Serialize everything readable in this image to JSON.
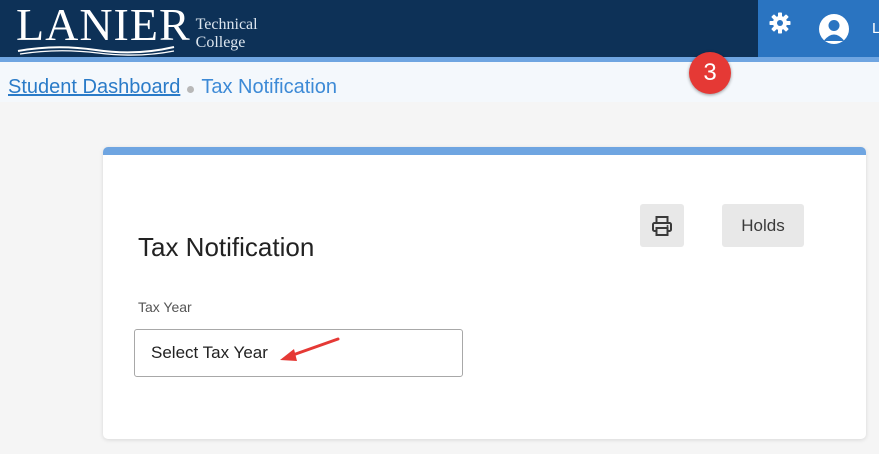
{
  "header": {
    "logo_main": "LANIER",
    "logo_sub_line1": "Technical",
    "logo_sub_line2": "College",
    "settings_icon": "gear-icon",
    "user_icon": "user-avatar-icon",
    "user_initial": "L"
  },
  "breadcrumb": {
    "items": [
      {
        "label": "Student Dashboard"
      },
      {
        "label": "Tax Notification"
      }
    ]
  },
  "annotation": {
    "step_number": "3"
  },
  "card": {
    "title": "Tax Notification",
    "print_icon": "printer-icon",
    "holds_label": "Holds",
    "tax_year_label": "Tax Year",
    "tax_year_select": "Select Tax Year"
  },
  "colors": {
    "header_bg": "#0d3157",
    "header_right_bg": "#2a74c1",
    "accent": "#6fa5e1",
    "link": "#2a7bc8",
    "badge": "#e53935",
    "button_bg": "#e8e8e8"
  }
}
